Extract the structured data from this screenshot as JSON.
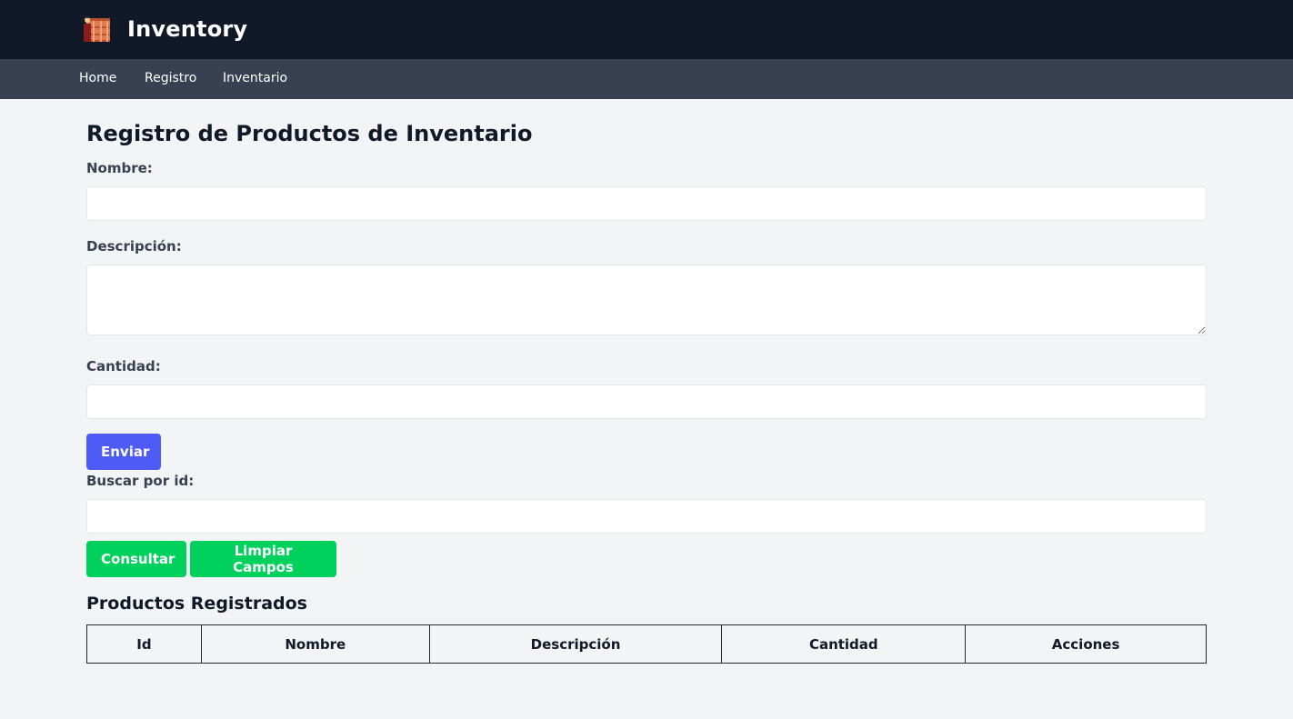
{
  "header": {
    "title": "Inventory",
    "logo_icon": "shelves-icon"
  },
  "nav": {
    "items": [
      {
        "label": "Home"
      },
      {
        "label": "Registro"
      },
      {
        "label": "Inventario"
      }
    ]
  },
  "form": {
    "title": "Registro de Productos de Inventario",
    "nombre_label": "Nombre:",
    "nombre_value": "",
    "descripcion_label": "Descripción:",
    "descripcion_value": "",
    "cantidad_label": "Cantidad:",
    "cantidad_value": "",
    "submit_label": "Enviar",
    "search_label": "Buscar por id:",
    "search_value": "",
    "consultar_label": "Consultar",
    "limpiar_label": "Limpiar Campos"
  },
  "table": {
    "title": "Productos Registrados",
    "columns": [
      "Id",
      "Nombre",
      "Descripción",
      "Cantidad",
      "Acciones"
    ],
    "rows": []
  },
  "colors": {
    "topbar": "#111827",
    "navbar": "#374151",
    "primary_button": "#4f5bf5",
    "green_button": "#00d15c",
    "background": "#f3f4f6"
  }
}
